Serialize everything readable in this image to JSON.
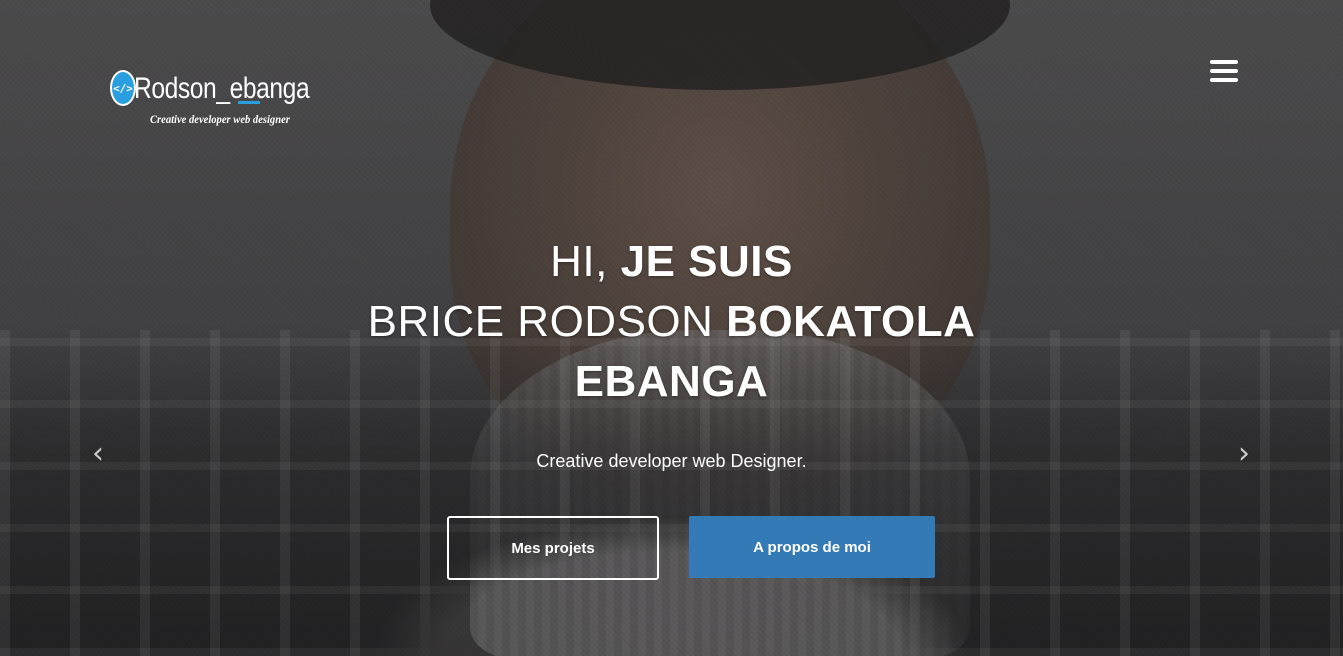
{
  "brand": {
    "logo_mark": "</>",
    "name": "Rodson_ebanga",
    "tagline": "Creative developer web designer"
  },
  "hero": {
    "greeting_light": "HI, ",
    "greeting_bold": "JE SUIS",
    "name_light": "BRICE RODSON ",
    "name_bold_1": "BOKATOLA",
    "name_bold_2": "EBANGA",
    "subtitle": "Creative developer web Designer."
  },
  "buttons": {
    "projects": "Mes projets",
    "about": "A propos de moi"
  },
  "carousel": {
    "prev_glyph": "‹",
    "next_glyph": "›"
  },
  "icons": {
    "menu": "hamburger-menu-icon",
    "prev": "chevron-left-icon",
    "next": "chevron-right-icon"
  },
  "colors": {
    "accent": "#337ab7",
    "logo_blue": "#2a9fe0"
  }
}
